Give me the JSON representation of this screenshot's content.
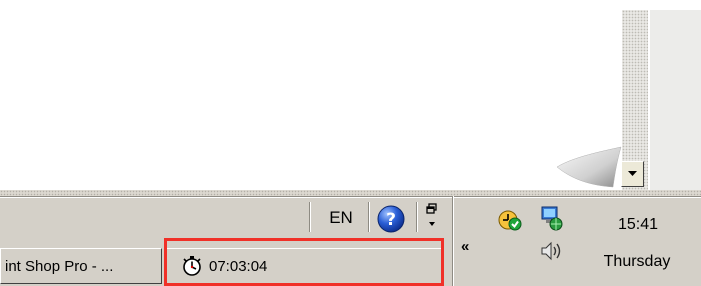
{
  "taskbar": {
    "language": "EN",
    "buttons": [
      {
        "label": "int Shop Pro - ...",
        "icon": "none"
      },
      {
        "label": "07:03:04",
        "icon": "stopwatch-icon"
      }
    ],
    "highlight_color": "#f03028"
  },
  "tray": {
    "time": "15:41",
    "day": "Thursday",
    "expand_label": "«",
    "icons": [
      "timer-check-icon",
      "network-globe-icon",
      "volume-icon"
    ]
  },
  "colors": {
    "taskbar": "#d4d0c8",
    "highlight": "#f03028"
  }
}
